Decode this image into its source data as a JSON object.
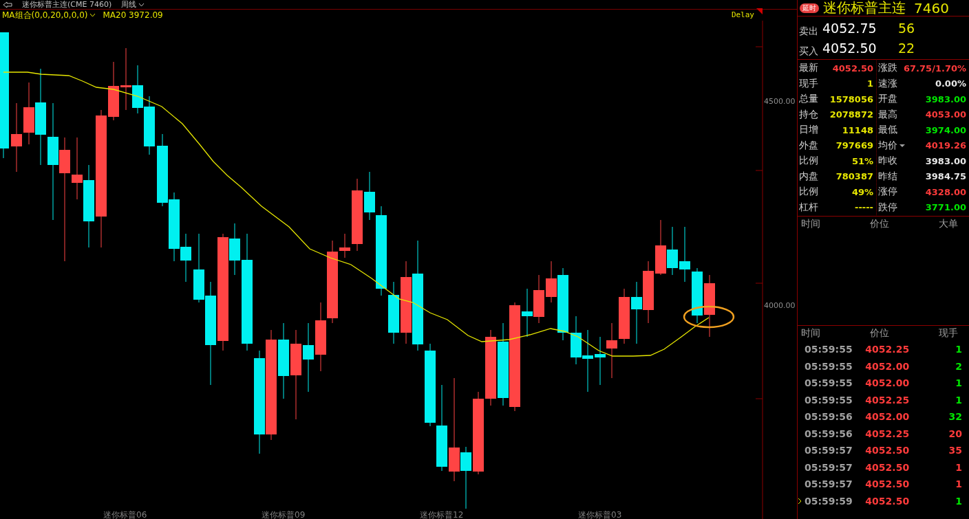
{
  "header": {
    "title": "迷你标普主连(CME 7460)",
    "period": "周线"
  },
  "indicator": {
    "label": "MA组合(0,0,20,0,0,0)",
    "value": "MA20 3972.09"
  },
  "chart": {
    "delay": "Delay",
    "y_labels": [
      "4500.00",
      "4000.00"
    ],
    "x_labels": [
      "迷你标普06",
      "迷你标普09",
      "迷你标普12",
      "迷你标普03"
    ]
  },
  "quote": {
    "badge": "延时",
    "name": "迷你标普主连",
    "code": "7460",
    "orders": [
      {
        "label": "卖出",
        "price": "4052.75",
        "volume": "56"
      },
      {
        "label": "买入",
        "price": "4052.50",
        "volume": "22"
      }
    ]
  },
  "stats_left": [
    {
      "label": "最新",
      "value": "4052.50",
      "color": "#ff3b3b",
      "has_menu": false
    },
    {
      "label": "现手",
      "value": "1",
      "color": "#e6e600",
      "has_menu": false
    },
    {
      "label": "总量",
      "value": "1578056",
      "color": "#e6e600",
      "has_menu": false
    },
    {
      "label": "持仓",
      "value": "2078872",
      "color": "#e6e600",
      "has_menu": false
    },
    {
      "label": "日增",
      "value": "11148",
      "color": "#e6e600",
      "has_menu": false
    },
    {
      "label": "外盘",
      "value": "797669",
      "color": "#e6e600",
      "has_menu": false
    },
    {
      "label": "比例",
      "value": "51%",
      "color": "#e6e600",
      "has_menu": false
    },
    {
      "label": "内盘",
      "value": "780387",
      "color": "#e6e600",
      "has_menu": false
    },
    {
      "label": "比例",
      "value": "49%",
      "color": "#e6e600",
      "has_menu": false
    },
    {
      "label": "杠杆",
      "value": "-----",
      "color": "#e6e600",
      "has_menu": false
    }
  ],
  "stats_right": [
    {
      "label": "涨跌",
      "value": "67.75/1.70%",
      "color": "#ff3b3b",
      "has_menu": false
    },
    {
      "label": "速涨",
      "value": "0.00%",
      "color": "#e8e8e8",
      "has_menu": false
    },
    {
      "label": "开盘",
      "value": "3983.00",
      "color": "#00e600",
      "has_menu": false
    },
    {
      "label": "最高",
      "value": "4053.00",
      "color": "#ff3b3b",
      "has_menu": false
    },
    {
      "label": "最低",
      "value": "3974.00",
      "color": "#00e600",
      "has_menu": false
    },
    {
      "label": "均价",
      "value": "4019.26",
      "color": "#ff3b3b",
      "has_menu": true
    },
    {
      "label": "昨收",
      "value": "3983.00",
      "color": "#e8e8e8",
      "has_menu": false
    },
    {
      "label": "昨结",
      "value": "3984.75",
      "color": "#e8e8e8",
      "has_menu": false
    },
    {
      "label": "涨停",
      "value": "4328.00",
      "color": "#ff3b3b",
      "has_menu": false
    },
    {
      "label": "跌停",
      "value": "3771.00",
      "color": "#00e600",
      "has_menu": false
    }
  ],
  "big_orders": {
    "columns": [
      "时间",
      "价位",
      "大单"
    ]
  },
  "ticks": {
    "columns": [
      "时间",
      "价位",
      "现手"
    ],
    "rows": [
      {
        "time": "05:59:55",
        "price": "4052.25",
        "volume": "1",
        "color": "#00e600",
        "selected": false
      },
      {
        "time": "05:59:55",
        "price": "4052.00",
        "volume": "2",
        "color": "#00e600",
        "selected": false
      },
      {
        "time": "05:59:55",
        "price": "4052.00",
        "volume": "1",
        "color": "#00e600",
        "selected": false
      },
      {
        "time": "05:59:55",
        "price": "4052.25",
        "volume": "1",
        "color": "#00e600",
        "selected": false
      },
      {
        "time": "05:59:56",
        "price": "4052.00",
        "volume": "32",
        "color": "#00e600",
        "selected": false
      },
      {
        "time": "05:59:56",
        "price": "4052.25",
        "volume": "20",
        "color": "#ff3b3b",
        "selected": false
      },
      {
        "time": "05:59:57",
        "price": "4052.50",
        "volume": "35",
        "color": "#ff3b3b",
        "selected": false
      },
      {
        "time": "05:59:57",
        "price": "4052.50",
        "volume": "1",
        "color": "#ff3b3b",
        "selected": false
      },
      {
        "time": "05:59:57",
        "price": "4052.50",
        "volume": "1",
        "color": "#ff3b3b",
        "selected": false
      },
      {
        "time": "05:59:59",
        "price": "4052.50",
        "volume": "1",
        "color": "#00e600",
        "selected": true
      }
    ]
  }
}
